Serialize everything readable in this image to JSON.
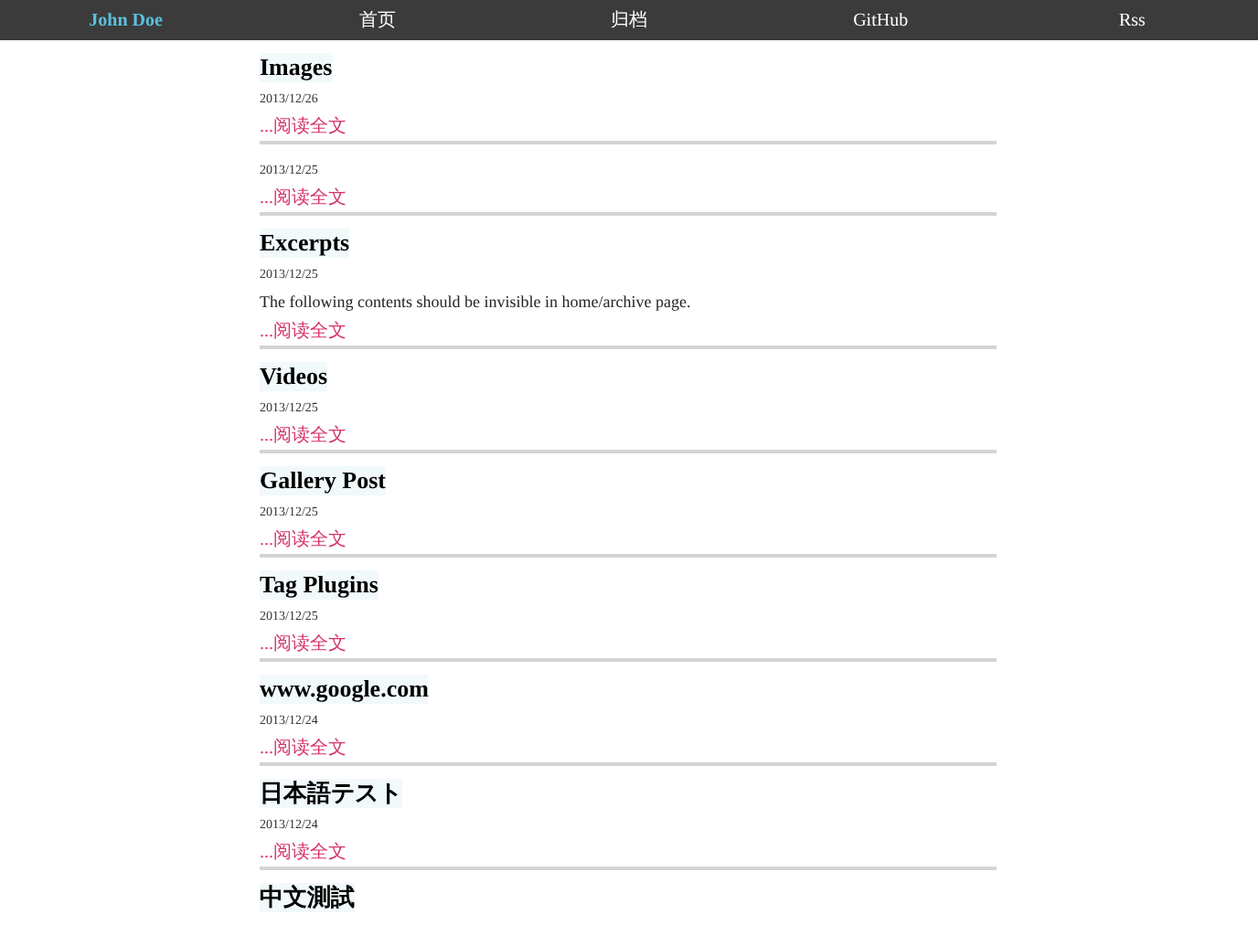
{
  "nav": {
    "items": [
      {
        "label": "John Doe",
        "selected": true
      },
      {
        "label": "首页",
        "selected": false
      },
      {
        "label": "归档",
        "selected": false
      },
      {
        "label": "GitHub",
        "selected": false
      },
      {
        "label": "Rss",
        "selected": false
      }
    ]
  },
  "posts": [
    {
      "title": "Images",
      "date": "2013/12/26",
      "read_more": "...阅读全文"
    },
    {
      "date": "2013/12/25",
      "read_more": "...阅读全文"
    },
    {
      "title": "Excerpts",
      "date": "2013/12/25",
      "excerpt": "The following contents should be invisible in home/archive page.",
      "read_more": "...阅读全文"
    },
    {
      "title": "Videos",
      "date": "2013/12/25",
      "read_more": "...阅读全文"
    },
    {
      "title": "Gallery Post",
      "date": "2013/12/25",
      "read_more": "...阅读全文"
    },
    {
      "title": "Tag Plugins",
      "date": "2013/12/25",
      "read_more": "...阅读全文"
    },
    {
      "title": "www.google.com",
      "date": "2013/12/24",
      "read_more": "...阅读全文"
    },
    {
      "title": "日本語テスト",
      "date": "2013/12/24",
      "read_more": "...阅读全文"
    },
    {
      "title": "中文測試"
    }
  ]
}
